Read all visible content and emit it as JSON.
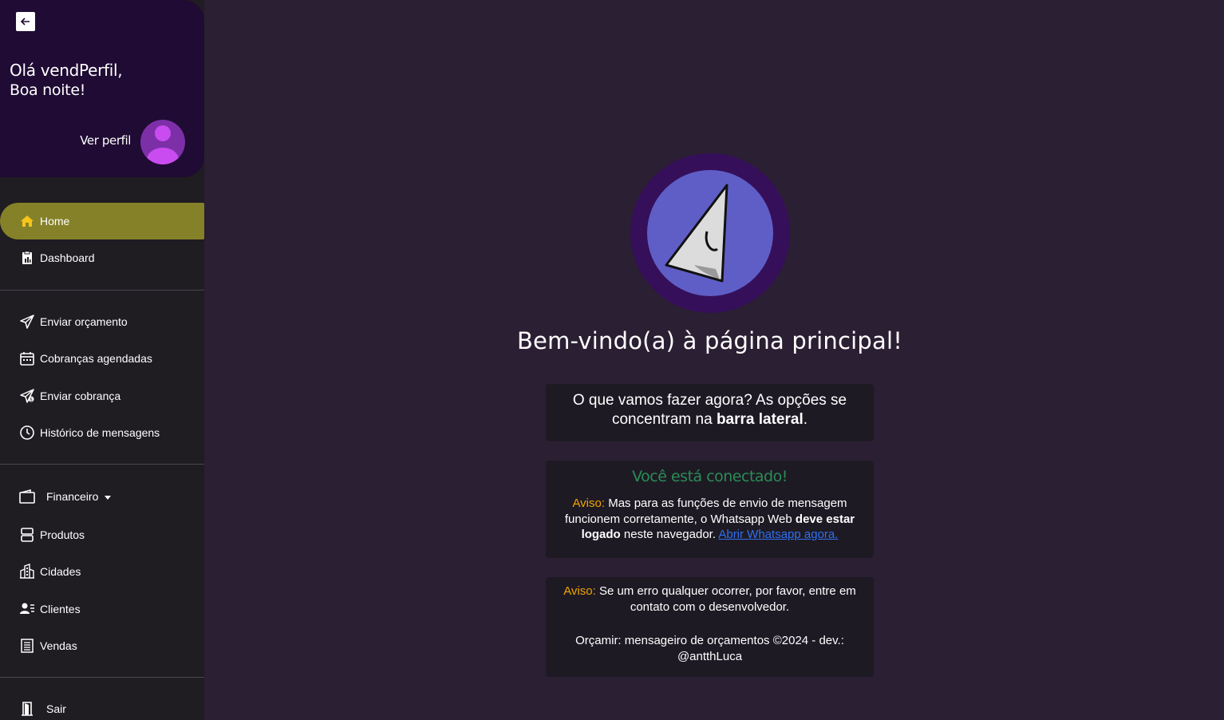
{
  "sidebar": {
    "greeting_line1": "Olá vendPerfil,",
    "greeting_line2": "Boa noite!",
    "view_profile": "Ver perfil",
    "items": [
      {
        "label": "Home",
        "icon": "home-icon",
        "active": true
      },
      {
        "label": "Dashboard",
        "icon": "clipboard-chart-icon"
      },
      {
        "label": "Enviar orçamento",
        "icon": "send-icon"
      },
      {
        "label": "Cobranças agendadas",
        "icon": "calendar-icon"
      },
      {
        "label": "Enviar cobrança",
        "icon": "send-money-icon"
      },
      {
        "label": "Histórico de mensagens",
        "icon": "clock-icon"
      },
      {
        "label": "Financeiro",
        "icon": "wallet-icon"
      },
      {
        "label": "Produtos",
        "icon": "boxes-icon"
      },
      {
        "label": "Cidades",
        "icon": "buildings-icon"
      },
      {
        "label": "Clientes",
        "icon": "contacts-icon"
      },
      {
        "label": "Vendas",
        "icon": "receipt-icon"
      },
      {
        "label": "Sair",
        "icon": "door-exit-icon"
      }
    ]
  },
  "main": {
    "welcome": "Bem-vindo(a) à página principal!",
    "intro_prefix": "O que vamos fazer agora? As opções se concentram na ",
    "intro_bold": "barra lateral",
    "intro_suffix": ".",
    "connected": "Você está conectado!",
    "warning1_label": "Aviso:",
    "warning1_text": " Mas para as funções de envio de mensagem funcionem corretamente, o Whatsapp Web ",
    "warning1_bold": "deve estar logado",
    "warning1_text2": " neste navegador. ",
    "warning1_link": "Abrir Whatsapp agora.",
    "warning2_label": "Aviso:",
    "warning2_text": " Se um erro qualquer ocorrer, por favor, entre em contato com o desenvolvedor.",
    "footer": "Orçamir: mensageiro de orçamentos ©2024 - dev.: @antthLuca"
  },
  "colors": {
    "background": "#2b1f33",
    "sidebar": "#1f1c22",
    "profile_card": "#1f0b33",
    "active_item": "#858129",
    "connected": "#2a8d56",
    "warning": "#f0a500",
    "link": "#2f6ff0"
  }
}
